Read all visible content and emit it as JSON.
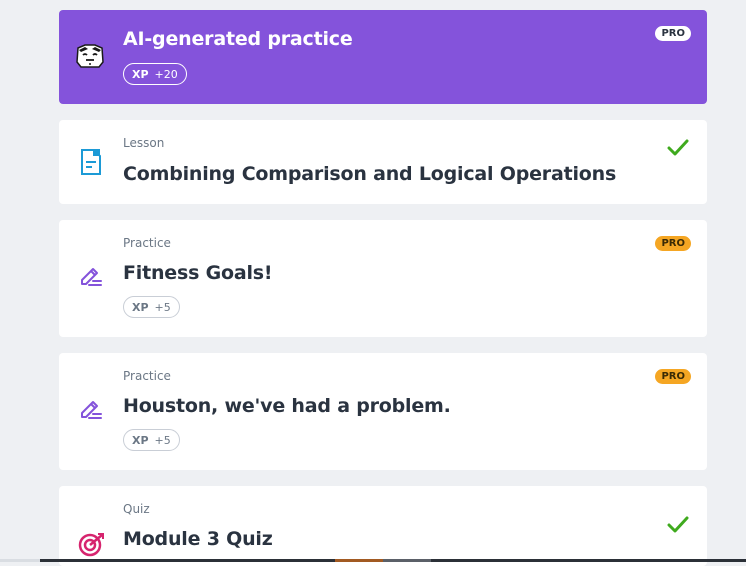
{
  "items": [
    {
      "type": "",
      "title": "AI-generated practice",
      "xp_label": "XP",
      "xp_value": "+20",
      "badge": "PRO",
      "icon": "ai-face-icon"
    },
    {
      "type": "Lesson",
      "title": "Combining Comparison and Logical Operations",
      "icon": "lesson-document-icon",
      "completed": true
    },
    {
      "type": "Practice",
      "title": "Fitness Goals!",
      "xp_label": "XP",
      "xp_value": "+5",
      "badge": "PRO",
      "icon": "practice-pencil-icon"
    },
    {
      "type": "Practice",
      "title": "Houston, we've had a problem.",
      "xp_label": "XP",
      "xp_value": "+5",
      "badge": "PRO",
      "icon": "practice-pencil-icon"
    },
    {
      "type": "Quiz",
      "title": "Module 3 Quiz",
      "icon": "quiz-target-icon",
      "completed": true
    }
  ],
  "colors": {
    "ai_card": "#8453db",
    "pro_badge": "#f5a623",
    "check": "#3faa1e",
    "pencil": "#8453db",
    "lesson_icon": "#1c9ad6",
    "quiz_icon": "#d6246e"
  }
}
